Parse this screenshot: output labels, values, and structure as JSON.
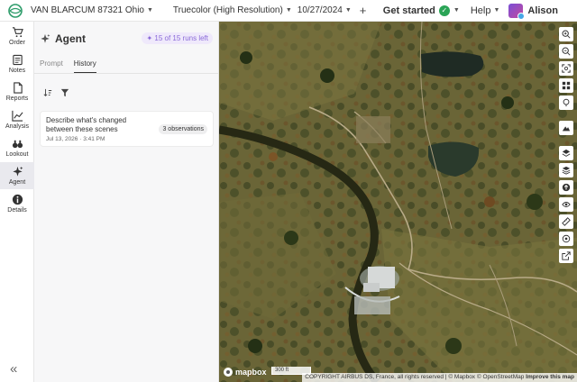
{
  "topbar": {
    "location": "VAN BLARCUM 87321 Ohio",
    "layer": "Truecolor (High Resolution)",
    "date": "10/27/2024",
    "add": "+",
    "get_started": "Get started",
    "help": "Help",
    "user": "Alison"
  },
  "nav": {
    "items": [
      {
        "label": "Order"
      },
      {
        "label": "Notes"
      },
      {
        "label": "Reports"
      },
      {
        "label": "Analysis"
      },
      {
        "label": "Lookout"
      },
      {
        "label": "Agent"
      },
      {
        "label": "Details"
      }
    ],
    "collapse": "«"
  },
  "panel": {
    "title": "Agent",
    "runs": "15 of 15 runs left",
    "tabs": [
      "Prompt",
      "History"
    ],
    "active_tab": "History",
    "history": [
      {
        "title": "Describe what's changed between these scenes",
        "time": "Jul 13, 2026 · 3:41 PM",
        "badge": "3 observations"
      }
    ]
  },
  "map": {
    "brand": "mapbox",
    "scale": "300 ft",
    "attribution_prefix": "COPYRIGHT AIRBUS DS, France, all rights reserved | © Mapbox © OpenStreetMap",
    "attribution_link": "Improve this map"
  },
  "colors": {
    "accent": "#8a6ad8",
    "success": "#2aa456"
  }
}
